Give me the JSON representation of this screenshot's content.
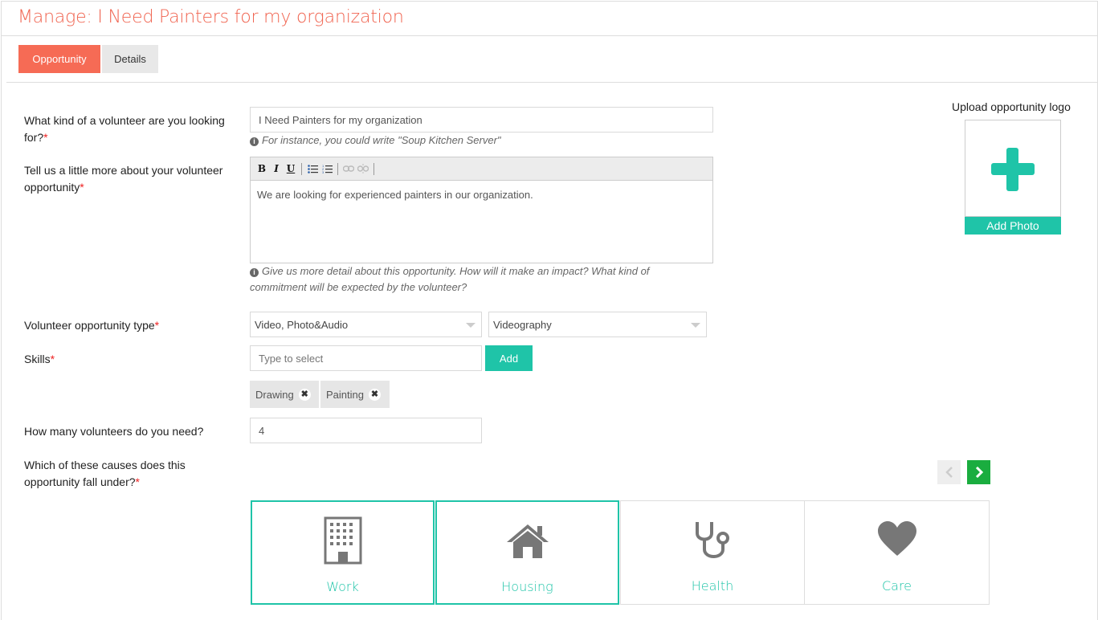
{
  "header": {
    "title": "Manage: I Need Painters for my organization"
  },
  "tabs": [
    {
      "label": "Opportunity"
    },
    {
      "label": "Details"
    }
  ],
  "form": {
    "title_q": {
      "label": "What kind of a volunteer are you looking for?",
      "required": "*",
      "value": "I Need Painters for my organization",
      "hint": "For instance, you could write \"Soup Kitchen Server\""
    },
    "description": {
      "label": "Tell us a little more about your volunteer opportunity",
      "required": "*",
      "value": "We are looking for experienced painters in our organization.",
      "hint": "Give us more detail about this opportunity. How will it make an impact? What kind of commitment will be expected by the volunteer?"
    },
    "type": {
      "label": "Volunteer opportunity type",
      "required": "*",
      "category": "Video, Photo&Audio",
      "subcategory": "Videography"
    },
    "skills": {
      "label": "Skills",
      "required": "*",
      "placeholder": "Type to select",
      "add_label": "Add",
      "chips": [
        "Drawing",
        "Painting"
      ]
    },
    "volunteers": {
      "label": "How many volunteers do you need?",
      "value": "4"
    },
    "causes": {
      "label": "Which of these causes does this opportunity fall under?",
      "required": "*",
      "items": [
        {
          "label": "Work",
          "icon": "building-icon",
          "selected": true
        },
        {
          "label": "Housing",
          "icon": "house-icon",
          "selected": true
        },
        {
          "label": "Health",
          "icon": "stethoscope-icon",
          "selected": false
        },
        {
          "label": "Care",
          "icon": "heart-icon",
          "selected": false
        }
      ]
    }
  },
  "logo": {
    "label": "Upload opportunity logo",
    "button": "Add Photo"
  },
  "editor_toolbar": [
    "B",
    "I",
    "U"
  ],
  "colors": {
    "accent": "#1fc4a8",
    "tab_active": "#f66b55",
    "title": "#f0634f",
    "next": "#1aad3f"
  }
}
